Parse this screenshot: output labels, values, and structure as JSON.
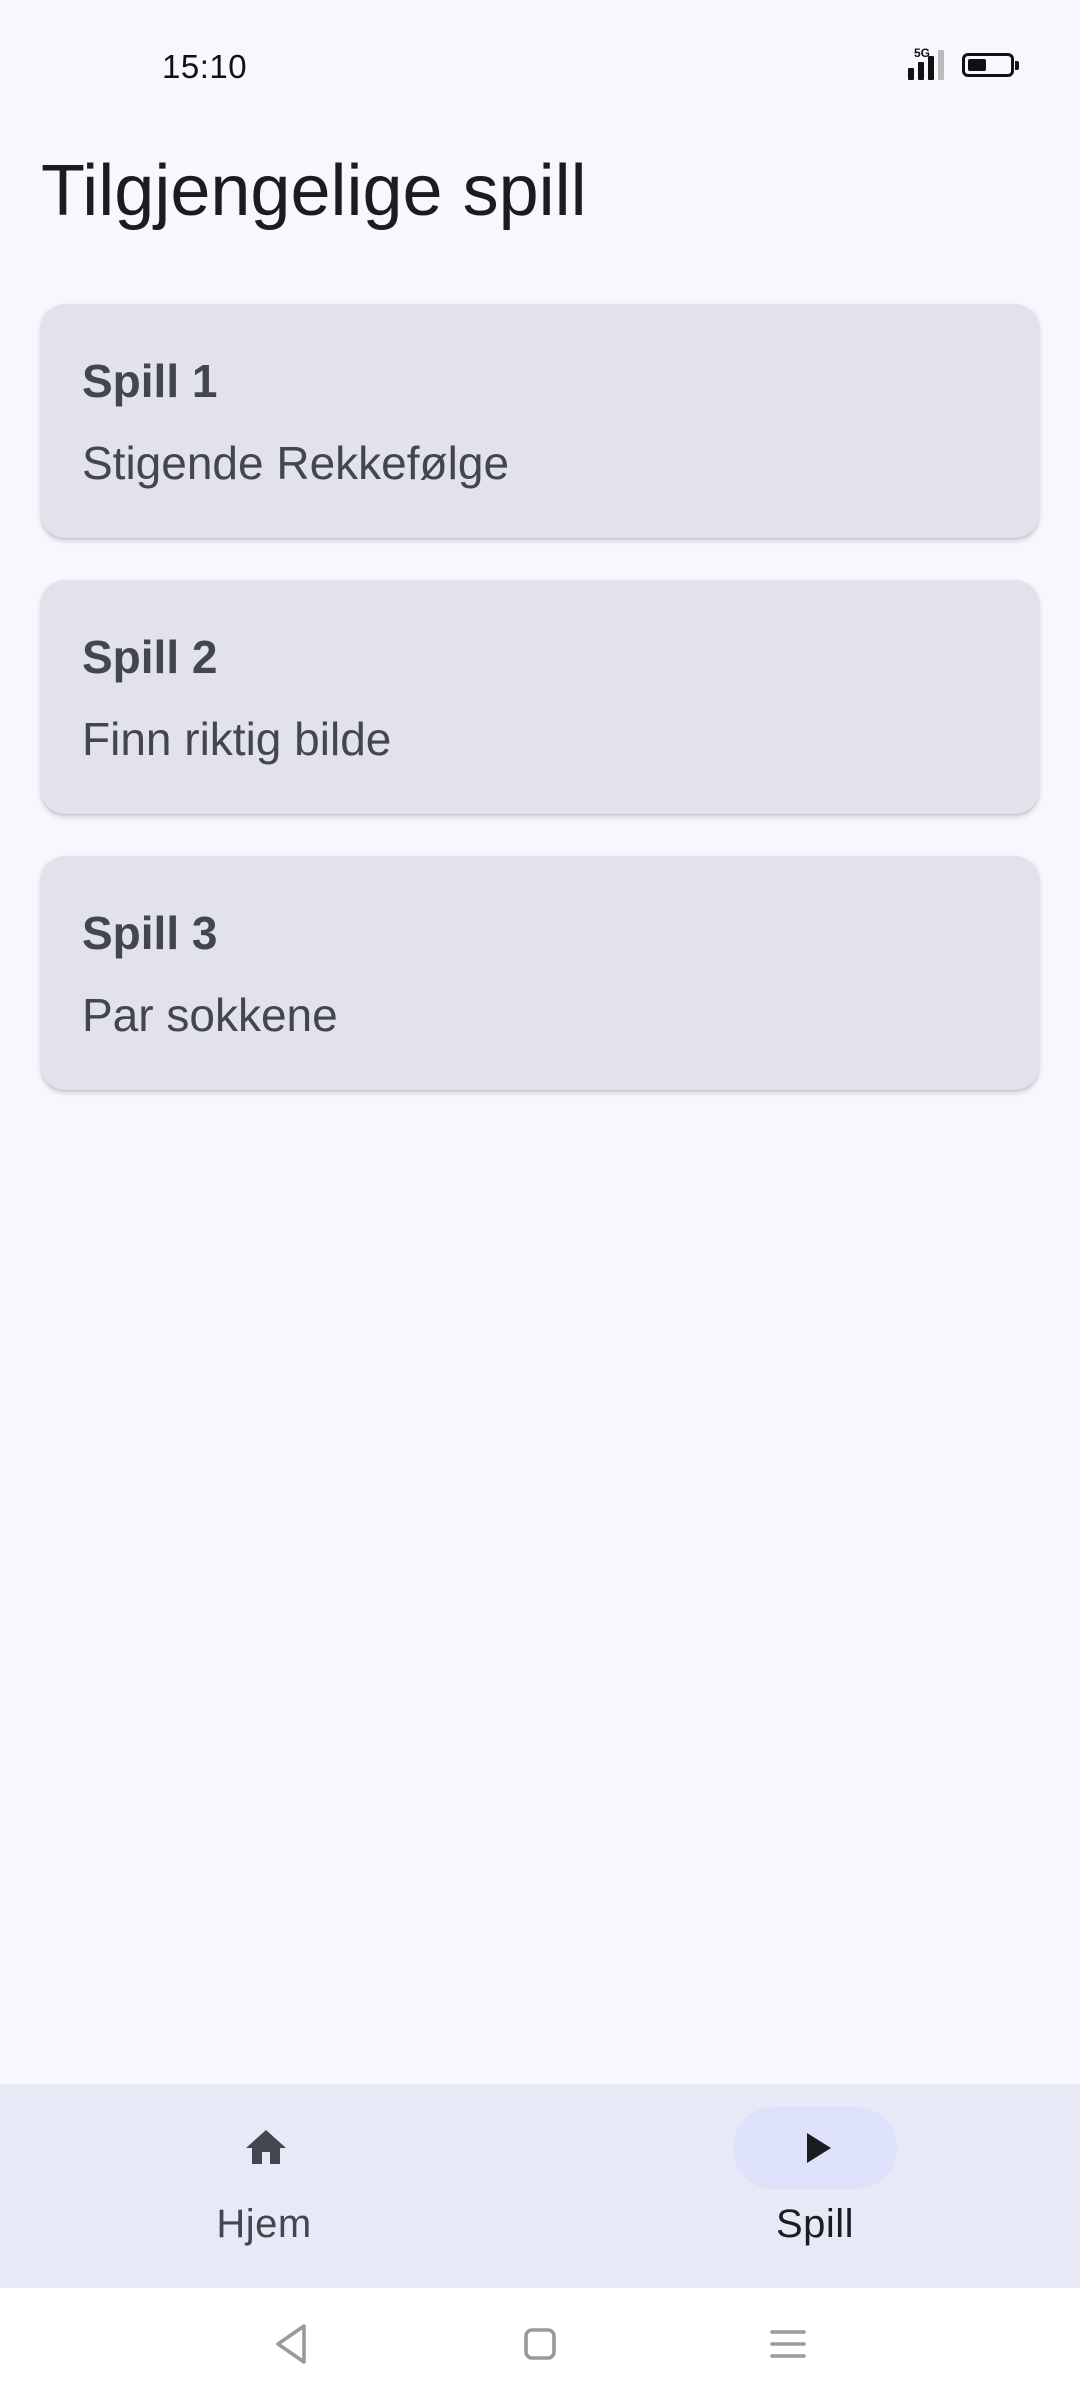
{
  "status_bar": {
    "time": "15:10",
    "network_label": "5G",
    "battery_level": 0.45
  },
  "page": {
    "title": "Tilgjengelige spill"
  },
  "games": [
    {
      "title": "Spill 1",
      "subtitle": "Stigende Rekkefølge"
    },
    {
      "title": "Spill 2",
      "subtitle": "Finn riktig bilde"
    },
    {
      "title": "Spill 3",
      "subtitle": "Par sokkene"
    }
  ],
  "bottom_nav": {
    "items": [
      {
        "label": "Hjem",
        "icon": "home-icon",
        "selected": false
      },
      {
        "label": "Spill",
        "icon": "play-icon",
        "selected": true
      }
    ]
  },
  "system_nav": {
    "buttons": [
      "back-icon",
      "home-square-icon",
      "menu-lines-icon"
    ]
  },
  "colors": {
    "background": "#f7f8fd",
    "card": "#e1e2ec",
    "nav_bar": "#e8e9f6",
    "nav_indicator": "#dde1f9",
    "text_primary": "#1b1c21",
    "text_secondary": "#44464f"
  }
}
